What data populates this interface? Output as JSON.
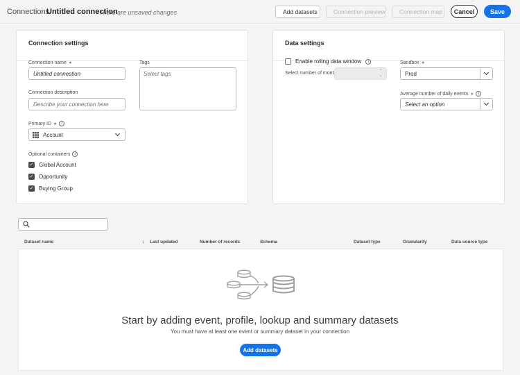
{
  "breadcrumb": {
    "parent": "Connections",
    "separator": "›",
    "title": "Untitled connection",
    "unsaved": "There are unsaved changes"
  },
  "toolbar": {
    "add_datasets": "Add datasets",
    "connection_preview": "Connection preview",
    "connection_map": "Connection map",
    "cancel": "Cancel",
    "save": "Save"
  },
  "connection_settings": {
    "title": "Connection settings",
    "name_label": "Connection name",
    "name_value": "Untitled connection",
    "tags_label": "Tags",
    "tags_placeholder": "Select tags",
    "description_label": "Connection description",
    "description_placeholder": "Describe your connection here",
    "primary_id_label": "Primary ID",
    "primary_id_value": "Account",
    "optional_containers_label": "Optional containers",
    "containers": [
      {
        "label": "Global Account",
        "checked": true
      },
      {
        "label": "Opportunity",
        "checked": true
      },
      {
        "label": "Buying Group",
        "checked": true
      }
    ]
  },
  "data_settings": {
    "title": "Data settings",
    "rolling_window_label": "Enable rolling data window",
    "rolling_window_checked": false,
    "months_label": "Select number of months",
    "sandbox_label": "Sandbox",
    "sandbox_value": "Prod",
    "daily_events_label": "Average number of daily events",
    "daily_events_placeholder": "Select an option"
  },
  "required_mark": "∗",
  "datasets_table": {
    "columns": [
      "Dataset name",
      "Last updated",
      "Number of records",
      "Schema",
      "Dataset type",
      "Granularity",
      "Data source type"
    ],
    "sort_indicator": "↓"
  },
  "empty_state": {
    "title": "Start by adding event, profile, lookup and summary datasets",
    "subtitle": "You must have at least one event or summary dataset in your connection",
    "button": "Add datasets"
  },
  "colors": {
    "accent": "#1473e6",
    "background": "#f4f4f4",
    "panel": "#ffffff"
  }
}
